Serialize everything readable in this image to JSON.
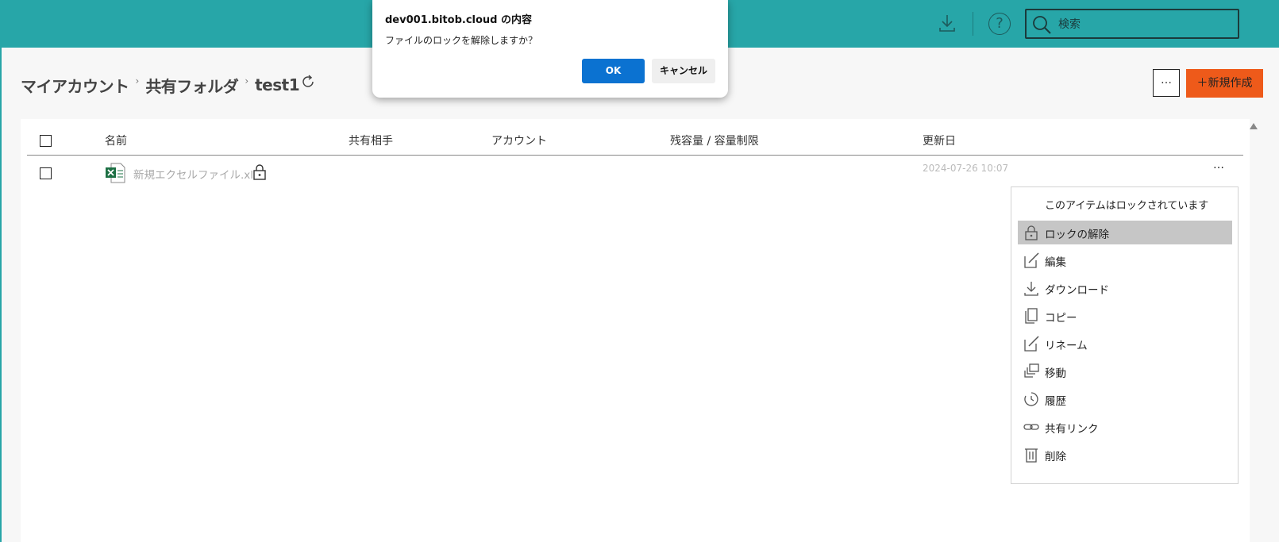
{
  "header": {
    "search_placeholder": "検索",
    "download_icon": "download-icon",
    "help_icon": "help-icon",
    "help_glyph": "?"
  },
  "breadcrumb": {
    "items": [
      "マイアカウント",
      "共有フォルダ",
      "test1"
    ],
    "separator": "›"
  },
  "toolbar": {
    "more_label": "…",
    "new_label": "＋新規作成"
  },
  "table": {
    "columns": [
      "名前",
      "共有相手",
      "アカウント",
      "残容量 / 容量制限",
      "更新日"
    ],
    "rows": [
      {
        "name": "新規エクセルファイル.xlsx",
        "updated": "2024-07-26 10:07",
        "more": "…",
        "locked": true
      }
    ]
  },
  "context_menu": {
    "header": "このアイテムはロックされています",
    "items": [
      {
        "label": "ロックの解除",
        "icon": "unlock-icon"
      },
      {
        "label": "編集",
        "icon": "edit-icon"
      },
      {
        "label": "ダウンロード",
        "icon": "download-icon"
      },
      {
        "label": "コピー",
        "icon": "copy-icon"
      },
      {
        "label": "リネーム",
        "icon": "rename-icon"
      },
      {
        "label": "移動",
        "icon": "move-icon"
      },
      {
        "label": "履歴",
        "icon": "history-icon"
      },
      {
        "label": "共有リンク",
        "icon": "link-icon"
      },
      {
        "label": "削除",
        "icon": "trash-icon"
      }
    ]
  },
  "dialog": {
    "title": "dev001.bitob.cloud の内容",
    "message": "ファイルのロックを解除しますか？",
    "ok_label": "OK",
    "cancel_label": "キャンセル"
  },
  "colors": {
    "header_bg": "#27a6a8",
    "primary_button": "#0b72d1",
    "new_button": "#ee5a1a",
    "menu_highlight": "#c6c6c6"
  }
}
